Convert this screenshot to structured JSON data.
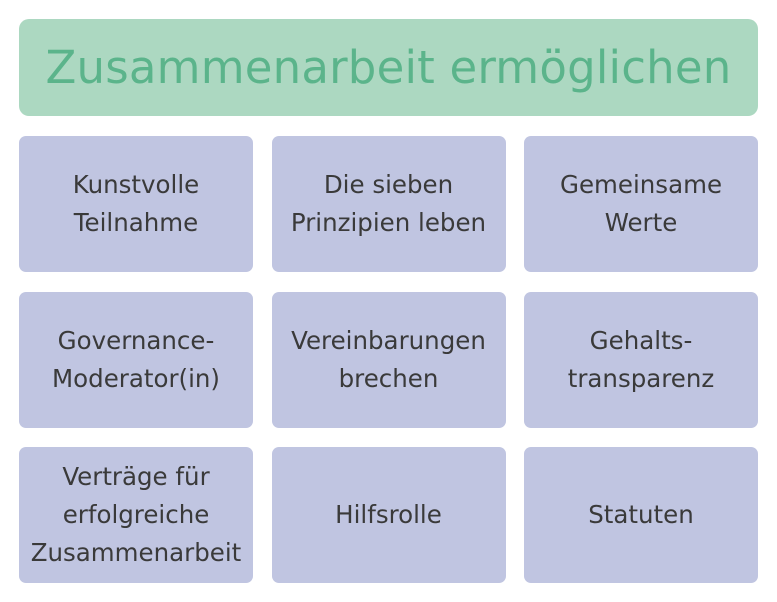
{
  "colors": {
    "header_bg": "#acd8c1",
    "header_text": "#5bb48b",
    "cell_bg": "#c0c5e1",
    "cell_text": "#3a3a3a"
  },
  "header": {
    "title": "Zusammenarbeit ermöglichen"
  },
  "cells": [
    {
      "label": "Kunstvolle\nTeilnahme"
    },
    {
      "label": "Die sieben\nPrinzipien leben"
    },
    {
      "label": "Gemeinsame\nWerte"
    },
    {
      "label": "Governance-\nModerator(in)"
    },
    {
      "label": "Vereinbarungen\nbrechen"
    },
    {
      "label": "Gehalts-\ntransparenz"
    },
    {
      "label": "Verträge für\nerfolgreiche\nZusammenarbeit"
    },
    {
      "label": "Hilfsrolle"
    },
    {
      "label": "Statuten"
    }
  ]
}
